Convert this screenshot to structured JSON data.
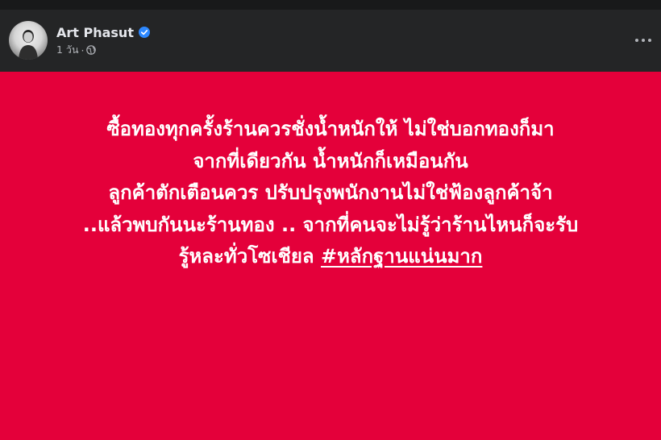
{
  "post": {
    "author": "Art Phasut",
    "verified": true,
    "time": "1 วัน",
    "separator": "·",
    "privacy_icon": "globe-icon",
    "more_icon": "more-options-icon",
    "background_color": "#e4003a",
    "lines": [
      "ซื้อทองทุกครั้งร้านควรชั่งน้ำหนักให้ ไม่ใช่บอกทองก็มา",
      "จากที่เดียวกัน น้ำหนักก็เหมือนกัน",
      "ลูกค้าตักเตือนควร ปรับปรุงพนักงานไม่ใช่ฟ้องลูกค้าจ้า",
      "..แล้วพบกันนะร้านทอง .. จากที่คนจะไม่รู้ว่าร้านไหนก็จะรับ"
    ],
    "last_line_text": "รู้หละทั่วโซเชียล",
    "hashtag": "#หลักฐานแน่นมาก"
  }
}
